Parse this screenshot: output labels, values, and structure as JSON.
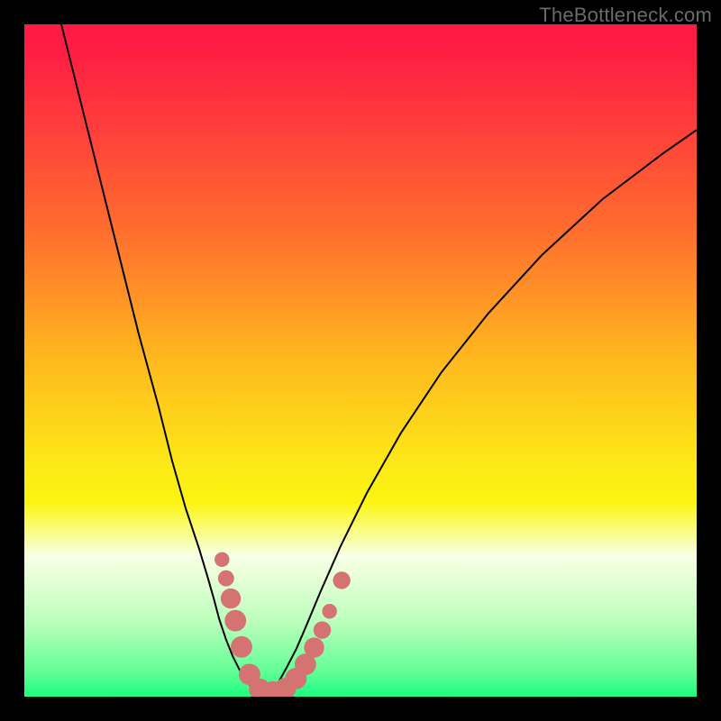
{
  "watermark": "TheBottleneck.com",
  "chart_data": {
    "type": "line",
    "title": "",
    "xlabel": "",
    "ylabel": "",
    "x_range": [
      0,
      100
    ],
    "y_range": [
      0,
      100
    ],
    "note": "Two V-shaped curves on a red→green vertical gradient; x/y are percent of plot area (0,0 = top-left). Values estimated from pixels; no axis ticks visible.",
    "series": [
      {
        "name": "left-curve",
        "x": [
          5.5,
          8,
          11,
          14,
          17,
          20,
          22,
          24,
          26,
          27.2,
          28.2,
          29,
          30,
          31,
          32,
          33,
          34,
          35
        ],
        "y": [
          0,
          10,
          22,
          34,
          46,
          57,
          65,
          72,
          78,
          82,
          85.5,
          88.5,
          91.5,
          94,
          96,
          97.6,
          98.8,
          99.5
        ]
      },
      {
        "name": "right-curve",
        "x": [
          36,
          37,
          38,
          39,
          40.5,
          42,
          44,
          47,
          51,
          56,
          62,
          69,
          77,
          86,
          95,
          100
        ],
        "y": [
          99.5,
          98.8,
          97.5,
          95.7,
          92.8,
          89.3,
          84.5,
          77.7,
          69.6,
          60.8,
          51.8,
          43,
          34.3,
          26,
          19.2,
          15.7
        ]
      }
    ],
    "markers": {
      "name": "pink-salmon-dots",
      "color": "#d57373",
      "points": [
        {
          "x": 29.4,
          "y": 79.6,
          "r": 1.1
        },
        {
          "x": 30.0,
          "y": 82.4,
          "r": 1.2
        },
        {
          "x": 30.7,
          "y": 85.4,
          "r": 1.5
        },
        {
          "x": 31.4,
          "y": 88.7,
          "r": 1.6
        },
        {
          "x": 32.3,
          "y": 92.6,
          "r": 1.6
        },
        {
          "x": 33.5,
          "y": 96.7,
          "r": 1.6
        },
        {
          "x": 35.0,
          "y": 98.9,
          "r": 1.6
        },
        {
          "x": 37.0,
          "y": 99.3,
          "r": 1.6
        },
        {
          "x": 38.8,
          "y": 98.8,
          "r": 1.6
        },
        {
          "x": 40.4,
          "y": 97.3,
          "r": 1.6
        },
        {
          "x": 41.8,
          "y": 95.2,
          "r": 1.6
        },
        {
          "x": 43.1,
          "y": 92.7,
          "r": 1.5
        },
        {
          "x": 44.3,
          "y": 90.1,
          "r": 1.3
        },
        {
          "x": 45.4,
          "y": 87.3,
          "r": 1.1
        },
        {
          "x": 47.2,
          "y": 82.7,
          "r": 1.3
        }
      ]
    },
    "gradient_stops": [
      {
        "pos": 0.0,
        "color": "#fe1b44"
      },
      {
        "pos": 0.14,
        "color": "#ff3a3c"
      },
      {
        "pos": 0.31,
        "color": "#ff6f2e"
      },
      {
        "pos": 0.5,
        "color": "#ffb91e"
      },
      {
        "pos": 0.66,
        "color": "#fcea17"
      },
      {
        "pos": 0.76,
        "color": "#f9fe93"
      },
      {
        "pos": 0.82,
        "color": "#e8ffd8"
      },
      {
        "pos": 0.96,
        "color": "#66fe97"
      },
      {
        "pos": 1.0,
        "color": "#1cfd82"
      }
    ]
  }
}
